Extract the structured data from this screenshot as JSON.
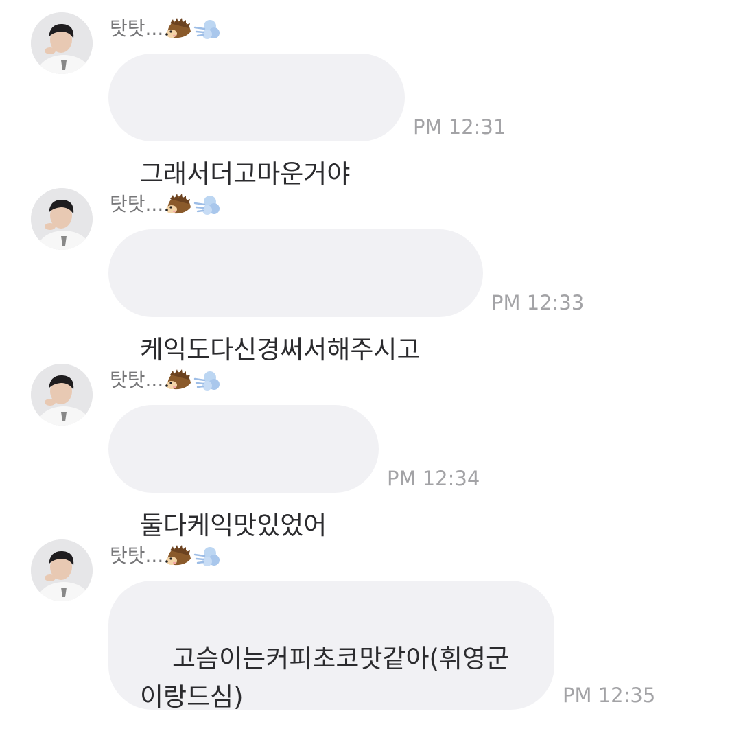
{
  "sender": {
    "name": "탓탓...",
    "emojis": [
      "hedgehog-icon",
      "dash-icon"
    ]
  },
  "messages": [
    {
      "text": "그래서더고마운거야",
      "time": "PM 12:31"
    },
    {
      "text": "케익도다신경써서해주시고",
      "time": "PM 12:33"
    },
    {
      "text": "둘다케익맛있었어",
      "time": "PM 12:34"
    },
    {
      "text": "고슴이는커피초코맛같아(휘영군\n이랑드심)",
      "time": "PM 12:35"
    }
  ],
  "colors": {
    "bubble": "#f1f1f4",
    "text": "#2b2b2e",
    "time": "#a3a3a6",
    "sender": "#777779"
  }
}
